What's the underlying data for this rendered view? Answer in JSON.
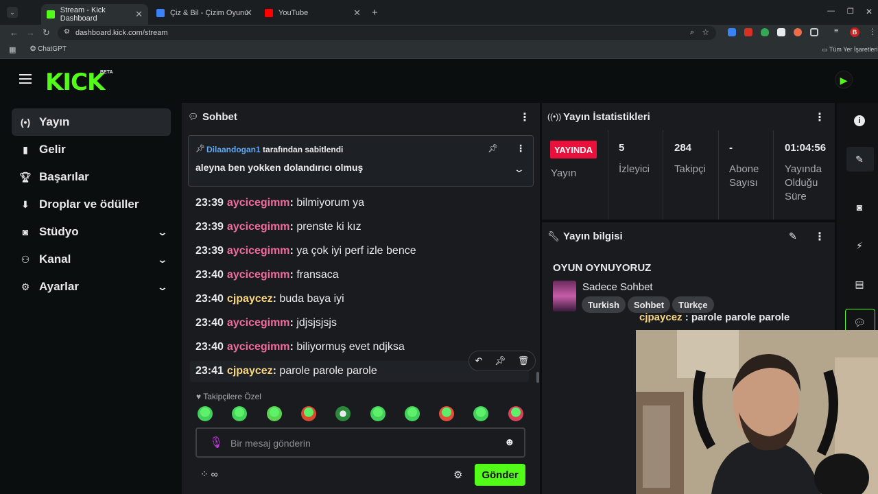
{
  "browser": {
    "tabs": [
      {
        "title": "Stream - Kick Dashboard",
        "active": true,
        "favicon_color": "#53fc18"
      },
      {
        "title": "Çiz & Bil - Çizim Oyunu",
        "active": false,
        "favicon_color": "#3b82f6"
      },
      {
        "title": "YouTube",
        "active": false,
        "favicon_color": "#ff0000"
      }
    ],
    "url": "dashboard.kick.com/stream",
    "bookmarks": [
      {
        "label": "ChatGPT"
      }
    ],
    "all_bookmarks_label": "Tüm Yer İşaretleri",
    "profile_initial": "B"
  },
  "app": {
    "logo_text": "KICK",
    "logo_badge": "BETA",
    "accent_color": "#53fc18"
  },
  "sidebar": {
    "items": [
      {
        "label": "Yayın",
        "icon": "broadcast-icon",
        "active": true,
        "expandable": false
      },
      {
        "label": "Gelir",
        "icon": "chart-icon",
        "active": false,
        "expandable": false
      },
      {
        "label": "Başarılar",
        "icon": "trophy-icon",
        "active": false,
        "expandable": false
      },
      {
        "label": "Droplar ve ödüller",
        "icon": "drops-icon",
        "active": false,
        "expandable": false
      },
      {
        "label": "Stüdyo",
        "icon": "studio-icon",
        "active": false,
        "expandable": true
      },
      {
        "label": "Kanal",
        "icon": "channel-icon",
        "active": false,
        "expandable": true
      },
      {
        "label": "Ayarlar",
        "icon": "gear-icon",
        "active": false,
        "expandable": true
      }
    ]
  },
  "chat": {
    "title": "Sohbet",
    "pinned": {
      "pinned_by_user": "Dilaandogan1",
      "pinned_by_suffix": "tarafından sabitlendi",
      "message": "aleyna ben yokken dolandırıcı olmuş"
    },
    "messages": [
      {
        "time": "23:39",
        "user": "aycicegimm",
        "user_color": "#f26b9e",
        "text": "bilmiyorum ya"
      },
      {
        "time": "23:39",
        "user": "aycicegimm",
        "user_color": "#f26b9e",
        "text": "prenste ki kız"
      },
      {
        "time": "23:39",
        "user": "aycicegimm",
        "user_color": "#f26b9e",
        "text": "ya çok iyi perf izle bence"
      },
      {
        "time": "23:40",
        "user": "aycicegimm",
        "user_color": "#f26b9e",
        "text": "fransaca"
      },
      {
        "time": "23:40",
        "user": "cjpaycez",
        "user_color": "#f8d57e",
        "text": "buda baya iyi"
      },
      {
        "time": "23:40",
        "user": "aycicegimm",
        "user_color": "#f26b9e",
        "text": "jdjsjsjsjs"
      },
      {
        "time": "23:40",
        "user": "aycicegimm",
        "user_color": "#f26b9e",
        "text": "biliyormuş evet ndjksa"
      },
      {
        "time": "23:41",
        "user": "cjpaycez",
        "user_color": "#f8d57e",
        "text": "parole parole parole"
      }
    ],
    "emote_section_label": "Takipçilere Özel",
    "emotes": [
      "emote-1",
      "emote-2",
      "emote-3",
      "emote-4",
      "emote-5",
      "emote-6",
      "emote-7",
      "emote-8",
      "emote-9",
      "emote-10"
    ],
    "input_placeholder": "Bir mesaj gönderin",
    "send_label": "Gönder"
  },
  "stats": {
    "title": "Yayın İstatistikleri",
    "live_badge": "YAYINDA",
    "status_label": "Yayın",
    "viewers": {
      "value": "5",
      "label": "İzleyici"
    },
    "followers": {
      "value": "284",
      "label": "Takipçi"
    },
    "subs": {
      "value": "-",
      "label_1": "Abone",
      "label_2": "Sayısı"
    },
    "uptime": {
      "value": "01:04:56",
      "label_1": "Yayında",
      "label_2": "Olduğu",
      "label_3": "Süre"
    }
  },
  "stream_info": {
    "title": "Yayın bilgisi",
    "stream_title": "OYUN OYNUYORUZ",
    "category": "Sadece Sohbet",
    "tags": [
      "Turkish",
      "Sohbet",
      "Türkçe"
    ]
  },
  "overlay": {
    "user": "cjpaycez",
    "text": ": parole parole parole"
  }
}
